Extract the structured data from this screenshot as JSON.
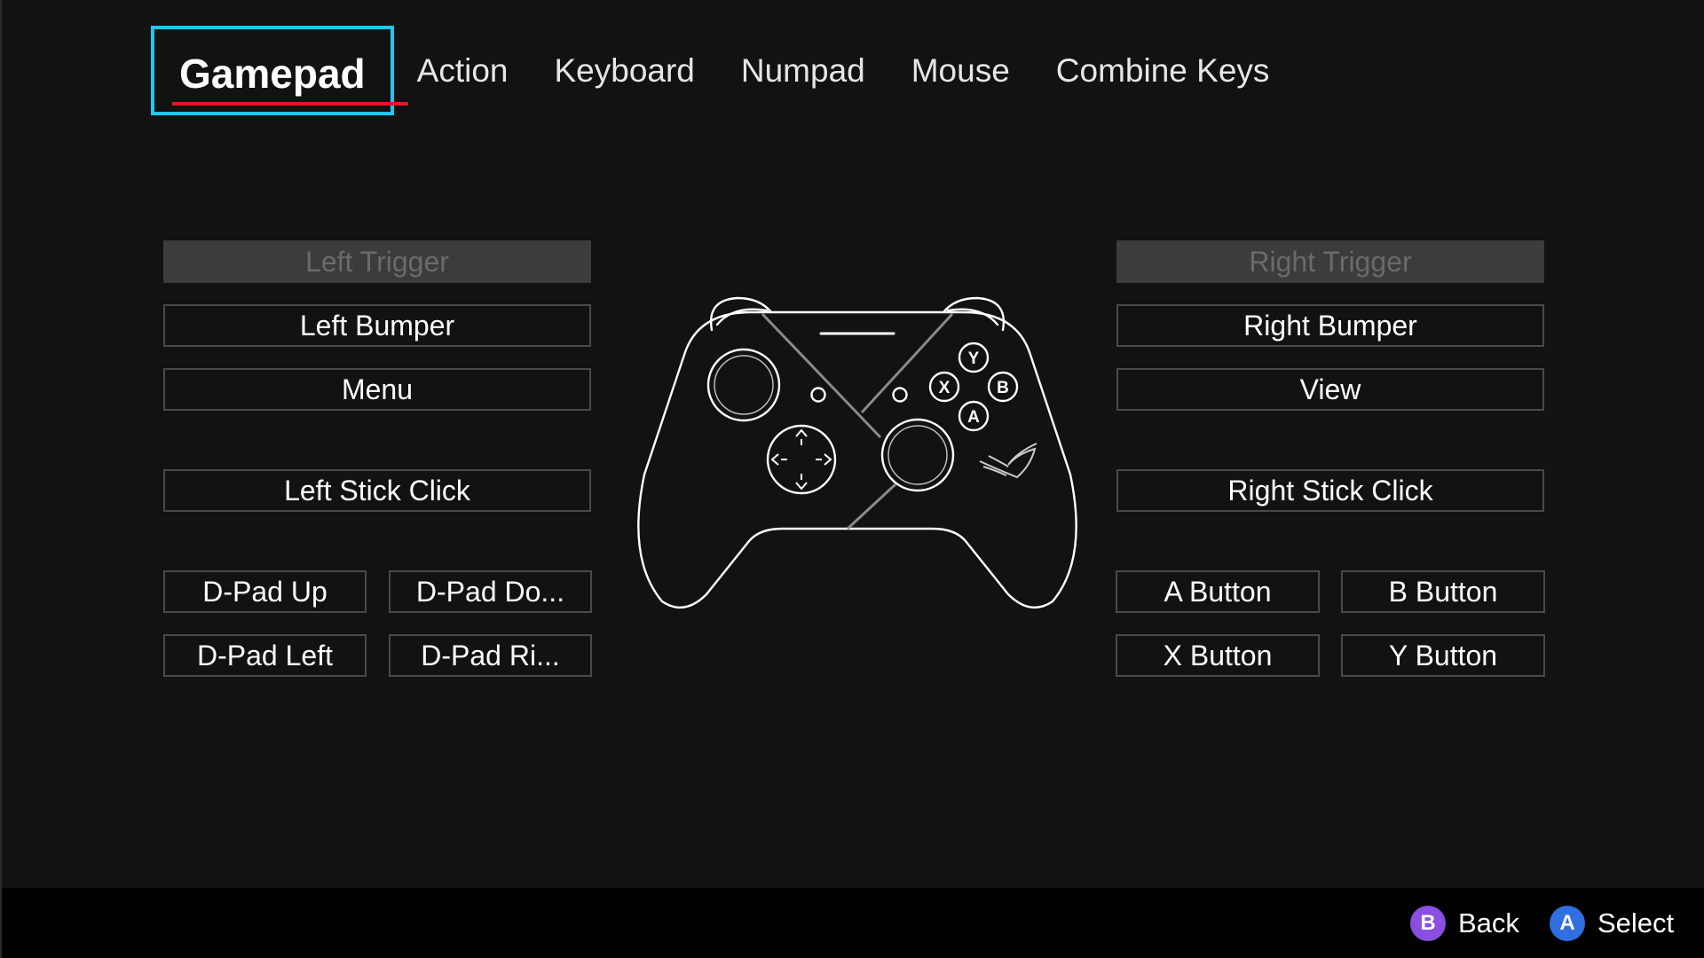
{
  "tabs": [
    {
      "label": "Gamepad",
      "active": true
    },
    {
      "label": "Action"
    },
    {
      "label": "Keyboard"
    },
    {
      "label": "Numpad"
    },
    {
      "label": "Mouse"
    },
    {
      "label": "Combine Keys"
    }
  ],
  "left": {
    "trigger": "Left Trigger",
    "bumper": "Left Bumper",
    "menu": "Menu",
    "stick_click": "Left Stick Click",
    "dpad_up": "D-Pad Up",
    "dpad_down": "D-Pad Do...",
    "dpad_left": "D-Pad Left",
    "dpad_right": "D-Pad Ri..."
  },
  "right": {
    "trigger": "Right Trigger",
    "bumper": "Right Bumper",
    "view": "View",
    "stick_click": "Right Stick Click",
    "a": "A Button",
    "b": "B Button",
    "x": "X Button",
    "y": "Y Button"
  },
  "controller": {
    "face_y": "Y",
    "face_x": "X",
    "face_b": "B",
    "face_a": "A"
  },
  "footer": {
    "back_badge": "B",
    "back_label": "Back",
    "back_color": "#8a4fe0",
    "select_badge": "A",
    "select_label": "Select",
    "select_color": "#2f6fe0"
  },
  "colors": {
    "focus": "#1ec8f0",
    "accent": "#e0182d"
  }
}
